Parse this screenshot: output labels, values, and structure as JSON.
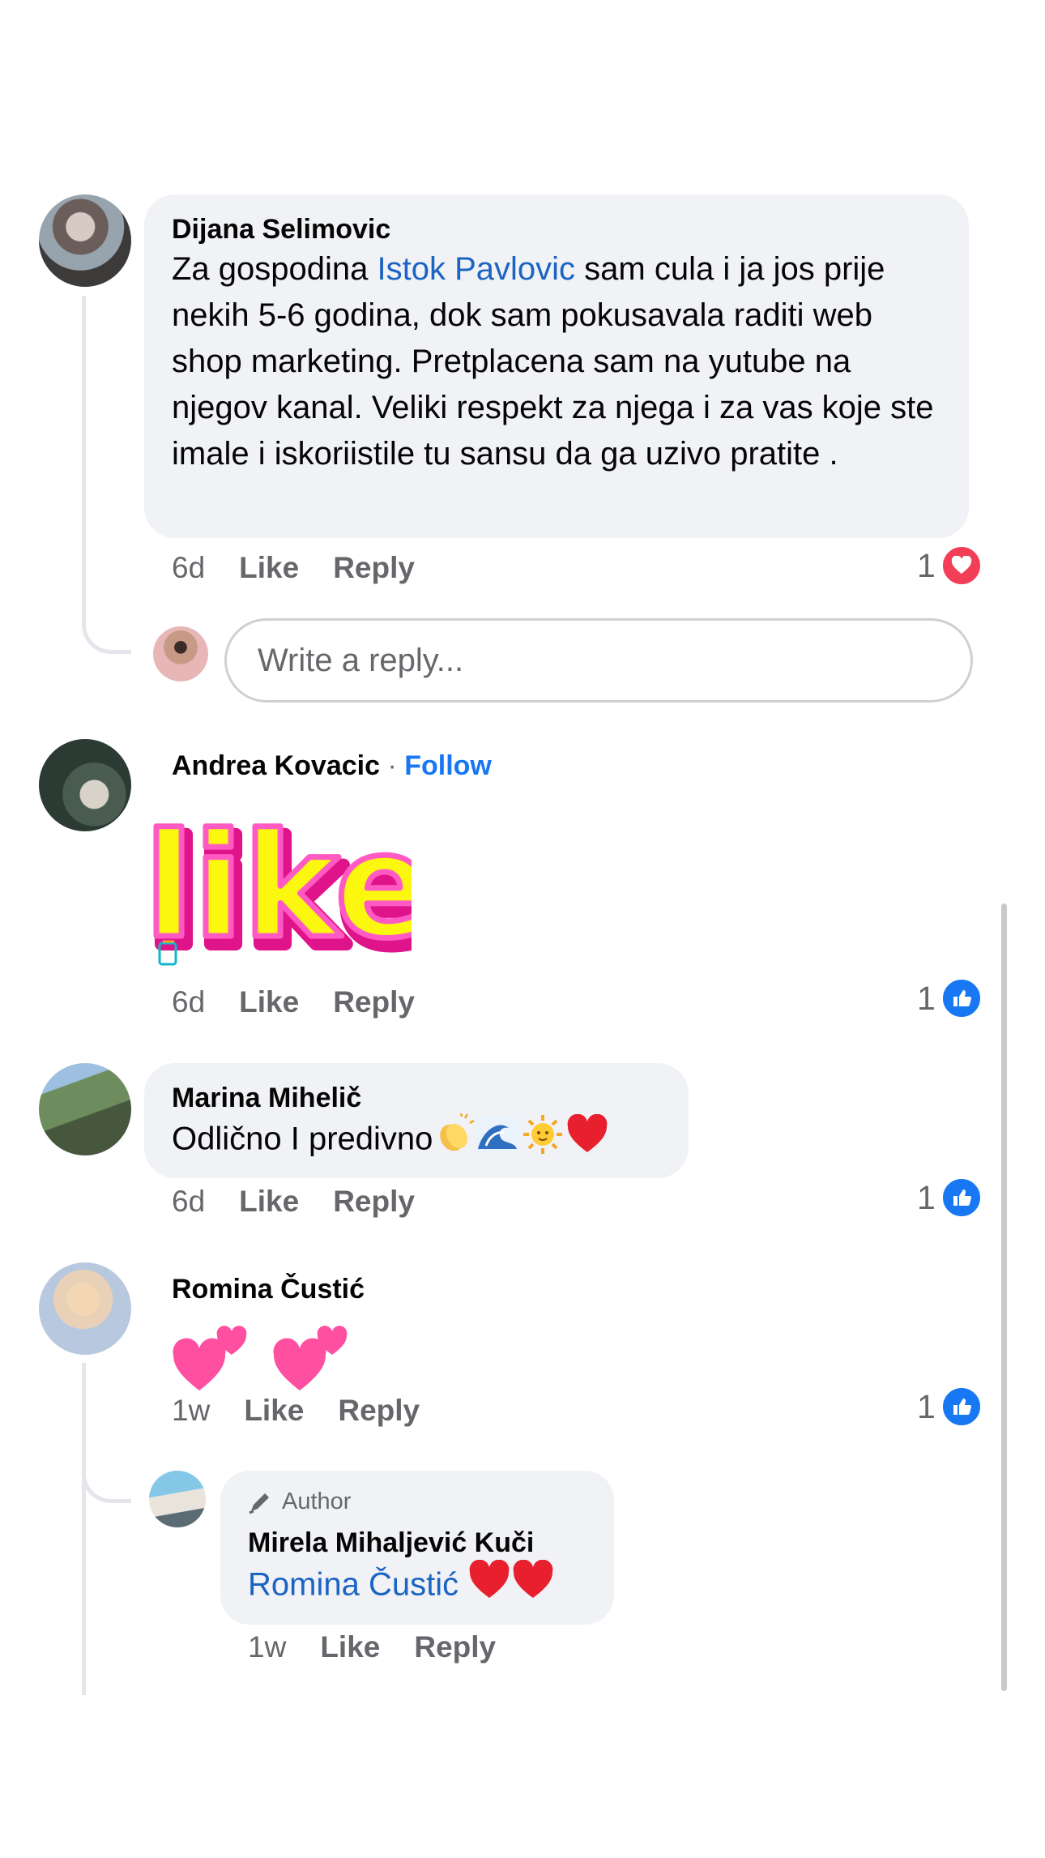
{
  "comments": [
    {
      "author": "Dijana Selimovic",
      "text_before": "Za gospodina ",
      "mention": "Istok Pavlovic",
      "text_line1_rest": " sam cula i ja jos prije",
      "text_rest": "nekih 5-6 godina, dok sam pokusavala raditi web shop marketing. Pretplacena sam na yutube na njegov kanal. Veliki respekt za njega i za vas koje ste imale i iskoriistile tu sansu da ga uzivo pratite .",
      "time": "6d",
      "like_label": "Like",
      "reply_label": "Reply",
      "reaction_count": "1",
      "reaction_icon": "heart-icon"
    },
    {
      "author": "Andrea Kovacic",
      "separator": "·",
      "follow_label": "Follow",
      "sticker_text": "like",
      "time": "6d",
      "like_label": "Like",
      "reply_label": "Reply",
      "reaction_count": "1",
      "reaction_icon": "thumbs-up-icon"
    },
    {
      "author": "Marina Mihelič",
      "text": "Odlično I predivno",
      "time": "6d",
      "like_label": "Like",
      "reply_label": "Reply",
      "reaction_count": "1",
      "reaction_icon": "thumbs-up-icon"
    },
    {
      "author": "Romina Čustić",
      "time": "1w",
      "like_label": "Like",
      "reply_label": "Reply",
      "reaction_count": "1",
      "reaction_icon": "thumbs-up-icon"
    }
  ],
  "reply_box": {
    "placeholder": "Write a reply..."
  },
  "author_reply": {
    "badge": "Author",
    "author": "Mirela Mihaljević Kuči",
    "mention": "Romina Čustić",
    "time": "1w",
    "like_label": "Like",
    "reply_label": "Reply"
  },
  "colors": {
    "link": "#1b64c4",
    "bubble": "#f0f2f5",
    "like_blue": "#1877f2",
    "love_red": "#f33e58"
  }
}
